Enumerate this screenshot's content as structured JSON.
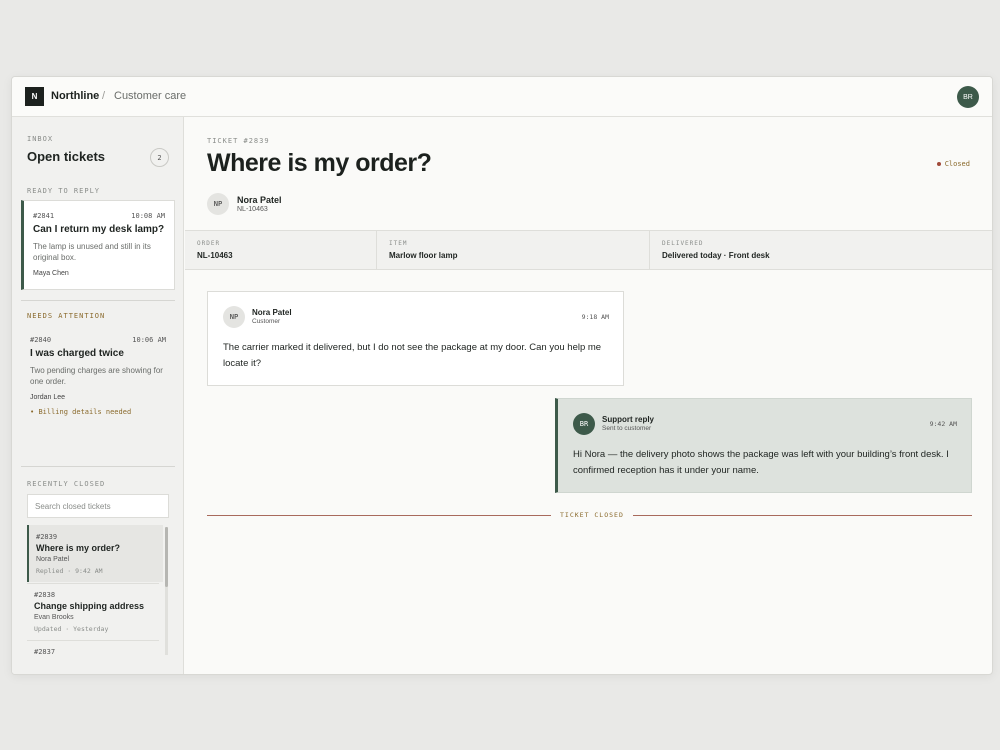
{
  "app": {
    "logo_letter": "N",
    "brand": "Northline",
    "separator": "/",
    "section": "Customer care",
    "user_initials": "BR"
  },
  "sidebar": {
    "inbox_label": "INBOX",
    "open_title": "Open tickets",
    "open_count": "2",
    "ready_label": "READY TO REPLY",
    "attention_label": "NEEDS ATTENTION",
    "closed_label": "RECENTLY CLOSED",
    "search_placeholder": "Search closed tickets",
    "open_tickets": [
      {
        "id": "#2841",
        "time": "10:08 AM",
        "title": "Can I return my desk lamp?",
        "desc": "The lamp is unused and still in its original box.",
        "customer": "Maya Chen"
      },
      {
        "id": "#2840",
        "time": "10:06 AM",
        "title": "I was charged twice",
        "desc": "Two pending charges are showing for one order.",
        "customer": "Jordan Lee",
        "flag": "Billing details needed"
      }
    ],
    "closed_tickets": [
      {
        "id": "#2839",
        "title": "Where is my order?",
        "customer": "Nora Patel",
        "meta": "Replied · 9:42 AM"
      },
      {
        "id": "#2838",
        "title": "Change shipping address",
        "customer": "Evan Brooks",
        "meta": "Updated · Yesterday"
      },
      {
        "id": "#2837"
      }
    ]
  },
  "ticket": {
    "label": "TICKET #2839",
    "title": "Where is my order?",
    "status": "Closed",
    "customer_initials": "NP",
    "customer_name": "Nora Patel",
    "customer_id": "NL-10463",
    "details": [
      {
        "label": "ORDER",
        "value": "NL-10463"
      },
      {
        "label": "ITEM",
        "value": "Marlow floor lamp"
      },
      {
        "label": "DELIVERED",
        "value": "Delivered today · Front desk"
      }
    ],
    "messages": [
      {
        "initials": "NP",
        "name": "Nora Patel",
        "role": "Customer",
        "time": "9:18 AM",
        "body": "The carrier marked it delivered, but I do not see the package at my door. Can you help me locate it?"
      },
      {
        "initials": "BR",
        "name": "Support reply",
        "role": "Sent to customer",
        "time": "9:42 AM",
        "body": "Hi Nora — the delivery photo shows the package was left with your building’s front desk. I confirmed reception has it under your name."
      }
    ],
    "closed_marker": "TICKET CLOSED"
  }
}
